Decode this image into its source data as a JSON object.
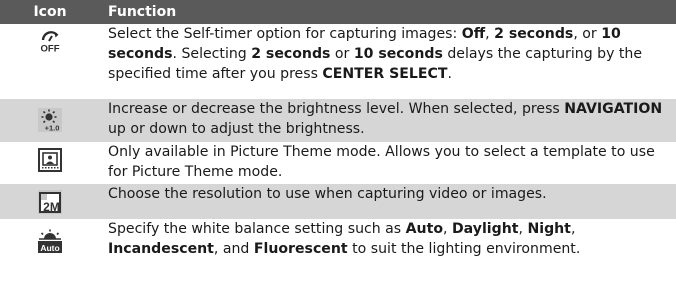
{
  "header": {
    "icon_label": "Icon",
    "function_label": "Function"
  },
  "rows": [
    {
      "icon": "self-timer-off-icon",
      "parts": [
        {
          "t": "Select the Self-timer option for capturing images: "
        },
        {
          "t": "Off",
          "b": true
        },
        {
          "t": ", "
        },
        {
          "t": "2 seconds",
          "b": true
        },
        {
          "t": ", or "
        },
        {
          "t": "10 seconds",
          "b": true
        },
        {
          "t": ". Selecting "
        },
        {
          "t": "2 seconds",
          "b": true
        },
        {
          "t": " or "
        },
        {
          "t": "10 seconds",
          "b": true
        },
        {
          "t": " delays the capturing by the specified time after you press "
        },
        {
          "t": "CENTER SELECT",
          "b": true
        },
        {
          "t": "."
        }
      ]
    },
    {
      "icon": "brightness-icon",
      "icon_text": "+1.0",
      "parts": [
        {
          "t": "Increase or decrease the brightness level. When selected, press "
        },
        {
          "t": "NAVIGATION",
          "b": true
        },
        {
          "t": " up or down to adjust the brightness."
        }
      ]
    },
    {
      "icon": "picture-theme-icon",
      "parts": [
        {
          "t": "Only available in Picture Theme mode. Allows you to select a template to use for Picture Theme mode."
        }
      ]
    },
    {
      "icon": "resolution-icon",
      "icon_text": "2M",
      "parts": [
        {
          "t": "Choose the resolution to use when capturing video or images."
        }
      ]
    },
    {
      "icon": "white-balance-auto-icon",
      "icon_text": "Auto",
      "parts": [
        {
          "t": "Specify the white balance setting such as "
        },
        {
          "t": "Auto",
          "b": true
        },
        {
          "t": ", "
        },
        {
          "t": "Daylight",
          "b": true
        },
        {
          "t": ", "
        },
        {
          "t": "Night",
          "b": true
        },
        {
          "t": ", "
        },
        {
          "t": "Incandescent",
          "b": true
        },
        {
          "t": ", and "
        },
        {
          "t": "Fluorescent",
          "b": true
        },
        {
          "t": " to suit the lighting environment."
        }
      ]
    }
  ]
}
